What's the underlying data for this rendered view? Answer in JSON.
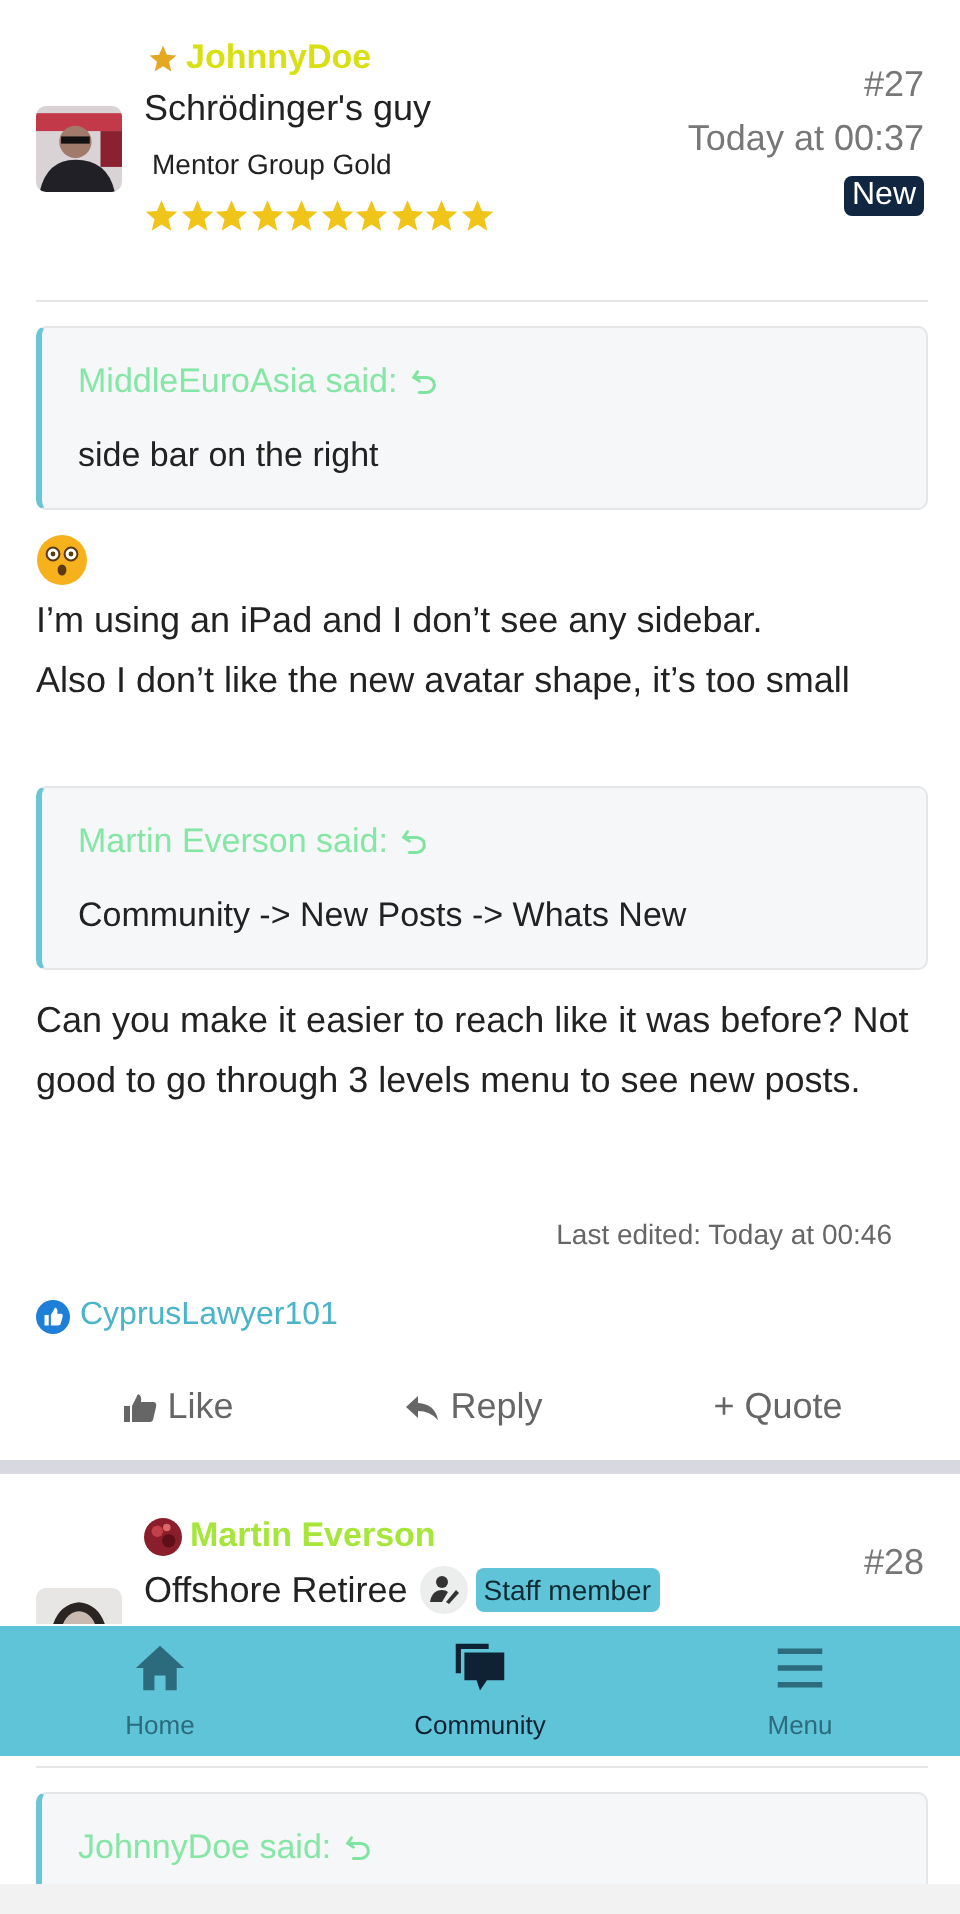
{
  "posts": [
    {
      "author": {
        "name": "JohnnyDoe",
        "color": "#d8e014",
        "title": "Schrödinger's guy",
        "group": "Mentor Group Gold",
        "stars": 10
      },
      "number": "#27",
      "time": "Today at 00:37",
      "new_badge": "New",
      "blocks": [
        {
          "kind": "quote",
          "author": "MiddleEuroAsia said:",
          "text": "side bar on the right"
        },
        {
          "kind": "emoji"
        },
        {
          "kind": "text",
          "text": "I’m using an iPad and I don’t see any sidebar.\nAlso I don’t like the new avatar shape, it’s too small"
        },
        {
          "kind": "quote",
          "author": "Martin Everson said:",
          "text": "Community -> New Posts -> Whats New"
        },
        {
          "kind": "text",
          "text": "Can you make it easier to reach like it was before? Not good to go through 3 levels menu to see new posts."
        }
      ],
      "edited": "Last edited: Today at 00:46",
      "likes": "CyprusLawyer101",
      "actions": [
        "Like",
        "Reply",
        "+ Quote"
      ]
    },
    {
      "author": {
        "name": "Martin Everson",
        "color": "#a6e63a",
        "title": "Offshore Retiree",
        "staff": "Staff member"
      },
      "number": "#28",
      "blocks": [
        {
          "kind": "quote",
          "author": "JohnnyDoe said:"
        }
      ]
    }
  ],
  "nav": [
    {
      "label": "Home",
      "selected": false
    },
    {
      "label": "Community",
      "selected": true
    },
    {
      "label": "Menu",
      "selected": false
    }
  ]
}
